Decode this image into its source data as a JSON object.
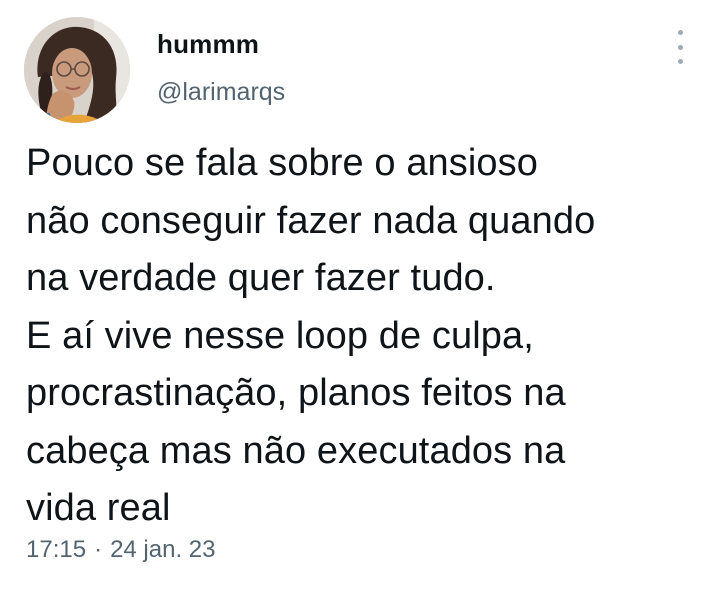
{
  "author": {
    "display_name": "hummm",
    "handle": "@larimarqs"
  },
  "tweet": {
    "lines": [
      "Pouco se fala sobre o ansioso",
      "não conseguir fazer nada quando",
      "na verdade quer fazer tudo.",
      "E aí vive nesse loop de culpa,",
      "procrastinação, planos feitos na",
      "cabeça mas não executados na",
      "vida real"
    ],
    "time": "17:15",
    "separator": "·",
    "date": "24 jan. 23"
  },
  "icons": {
    "more": "more-vertical-icon",
    "avatar": "profile-photo"
  },
  "colors": {
    "text_primary": "#0f1419",
    "text_secondary": "#536471",
    "menu_dots": "#a0aab3",
    "background": "#ffffff"
  }
}
